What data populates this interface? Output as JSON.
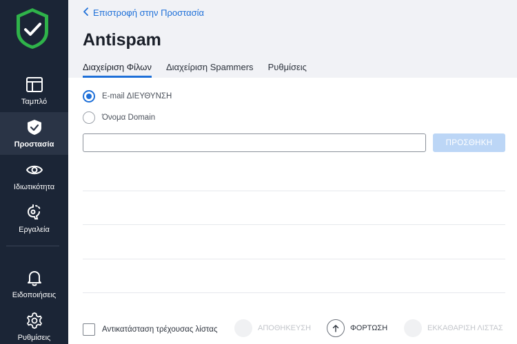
{
  "sidebar": {
    "items": [
      {
        "label": "Ταμπλό",
        "icon": "dashboard-icon"
      },
      {
        "label": "Προστασία",
        "icon": "shield-check-icon",
        "active": true
      },
      {
        "label": "Ιδιωτικότητα",
        "icon": "eye-icon"
      },
      {
        "label": "Εργαλεία",
        "icon": "tools-icon"
      },
      {
        "label": "Ειδοποιήσεις",
        "icon": "bell-icon"
      },
      {
        "label": "Ρυθμίσεις",
        "icon": "gear-icon"
      }
    ]
  },
  "header": {
    "back_label": "Επιστροφή στην Προστασία",
    "title": "Antispam",
    "tabs": [
      {
        "label": "Διαχείριση Φίλων",
        "active": true
      },
      {
        "label": "Διαχείριση Spammers"
      },
      {
        "label": "Ρυθμίσεις"
      }
    ]
  },
  "form": {
    "radio_email_label": "E-mail ΔΙΕΥΘΥΝΣΗ",
    "radio_email_checked": true,
    "radio_domain_label": "Όνομα Domain",
    "input_value": "",
    "add_button_label": "ΠΡΟΣΘΗΚΗ"
  },
  "footer": {
    "replace_list_label": "Αντικατάσταση τρέχουσας λίστας",
    "save_label": "ΑΠΟΘΗΚΕΥΣΗ",
    "upload_label": "ΦΟΡΤΩΣΗ",
    "clear_label": "ΕΚΚΑΘΑΡΙΣΗ ΛΙΣΤΑΣ"
  },
  "colors": {
    "sidebar_bg": "#1b2536",
    "accent": "#1d6fd8",
    "logo_green": "#2fb34a",
    "header_bg": "#f1f2f6"
  }
}
